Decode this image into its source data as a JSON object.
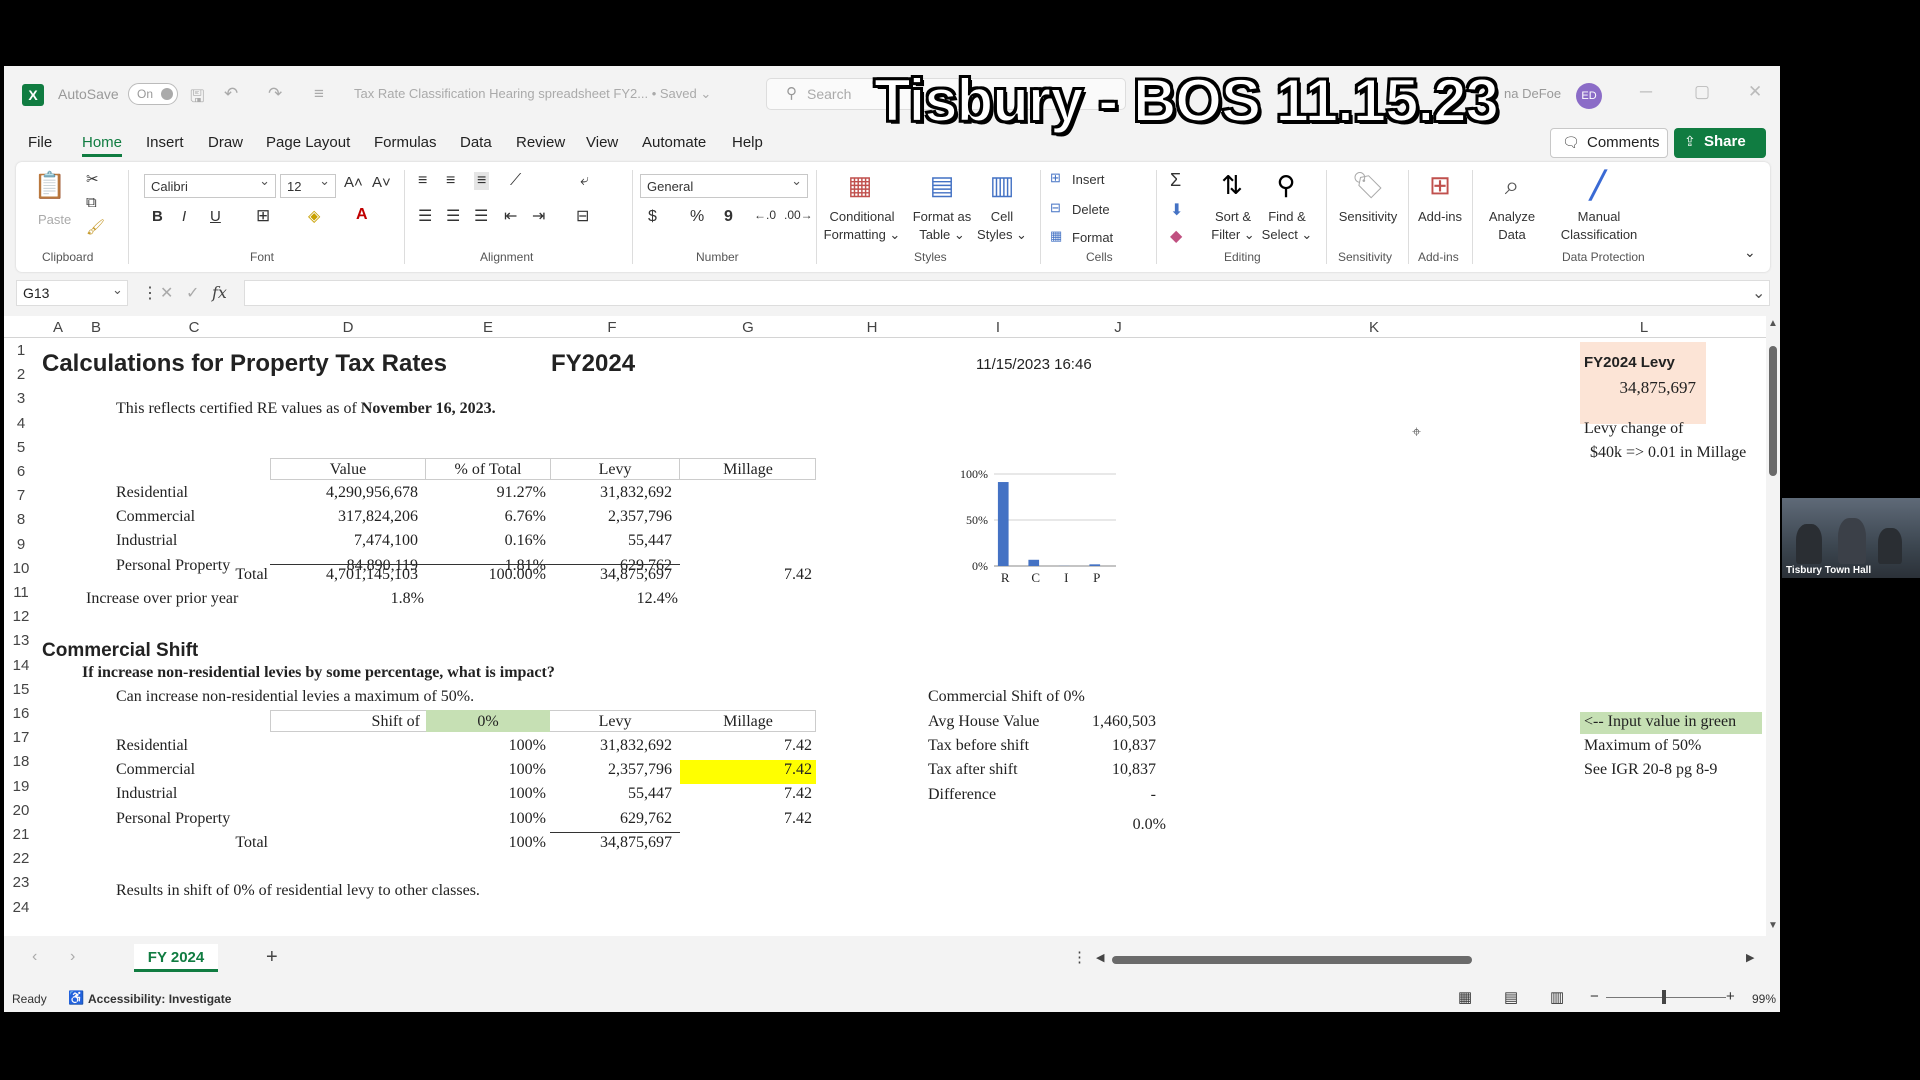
{
  "window": {
    "autosave_label": "AutoSave",
    "autosave_state": "On",
    "doc_title": "Tax Rate Classification Hearing spreadsheet FY2... • Saved ⌄",
    "search_placeholder": "Search",
    "overlay_title": "Tisbury - BOS 11.15.23",
    "username": "na DeFoe",
    "avatar_initials": "ED"
  },
  "menu": [
    "File",
    "Home",
    "Insert",
    "Draw",
    "Page Layout",
    "Formulas",
    "Data",
    "Review",
    "View",
    "Automate",
    "Help"
  ],
  "comments_label": "Comments",
  "share_label": "Share",
  "ribbon": {
    "clipboard": {
      "paste": "Paste",
      "group": "Clipboard"
    },
    "font": {
      "name": "Calibri",
      "size": "12",
      "group": "Font",
      "bold": "B",
      "italic": "I",
      "underline": "U"
    },
    "alignment": {
      "group": "Alignment"
    },
    "number": {
      "format": "General",
      "group": "Number",
      "currency": "$",
      "percent": "%",
      "comma": "9"
    },
    "styles": {
      "conditional": "Conditional\nFormatting ⌄",
      "format_table": "Format as\nTable ⌄",
      "cell_styles": "Cell\nStyles ⌄",
      "group": "Styles"
    },
    "cells": {
      "insert": "Insert",
      "delete": "Delete",
      "format": "Format",
      "group": "Cells"
    },
    "editing": {
      "sort": "Sort &\nFilter ⌄",
      "find": "Find &\nSelect ⌄",
      "group": "Editing"
    },
    "sensitivity": {
      "label": "Sensitivity",
      "group": "Sensitivity"
    },
    "addins": {
      "label": "Add-ins",
      "group": "Add-ins"
    },
    "analyze": {
      "label": "Analyze\nData"
    },
    "manual": {
      "label": "Manual\nClassification",
      "group": "Data Protection"
    }
  },
  "namebox": "G13",
  "columns": [
    "A",
    "B",
    "C",
    "D",
    "E",
    "F",
    "G",
    "H",
    "I",
    "J",
    "K",
    "L"
  ],
  "rows": [
    "1",
    "2",
    "3",
    "4",
    "5",
    "6",
    "7",
    "8",
    "9",
    "10",
    "11",
    "12",
    "13",
    "14",
    "15",
    "16",
    "17",
    "18",
    "19",
    "20",
    "21",
    "22",
    "23",
    "24"
  ],
  "sheet": {
    "title": "Calculations for Property Tax Rates",
    "fy": "FY2024",
    "timestamp": "11/15/2023 16:46",
    "note_pre": "This reflects certified RE values as of ",
    "note_date": "November 16, 2023.",
    "table1": {
      "headers": [
        "Value",
        "% of Total",
        "Levy",
        "Millage"
      ],
      "rows": [
        {
          "label": "Residential",
          "value": "4,290,956,678",
          "pct": "91.27%",
          "levy": "31,832,692"
        },
        {
          "label": "Commercial",
          "value": "317,824,206",
          "pct": "6.76%",
          "levy": "2,357,796"
        },
        {
          "label": "Industrial",
          "value": "7,474,100",
          "pct": "0.16%",
          "levy": "55,447"
        },
        {
          "label": "Personal Property",
          "value": "84,890,119",
          "pct": "1.81%",
          "levy": "629,762"
        }
      ],
      "total": {
        "label": "Total",
        "value": "4,701,145,103",
        "pct": "100.00%",
        "levy": "34,875,697",
        "millage": "7.42"
      },
      "increase": {
        "label": "Increase over prior year",
        "value": "1.8%",
        "levy": "12.4%"
      }
    },
    "section2_title": "Commercial Shift",
    "section2_question": "If increase non-residential levies by some percentage, what is impact?",
    "section2_note": "Can increase non-residential levies a maximum of 50%.",
    "table2": {
      "shift_label": "Shift of",
      "shift_value": "0%",
      "headers": [
        "Levy",
        "Millage"
      ],
      "rows": [
        {
          "label": "Residential",
          "pct": "100%",
          "levy": "31,832,692",
          "millage": "7.42"
        },
        {
          "label": "Commercial",
          "pct": "100%",
          "levy": "2,357,796",
          "millage": "7.42"
        },
        {
          "label": "Industrial",
          "pct": "100%",
          "levy": "55,447",
          "millage": "7.42"
        },
        {
          "label": "Personal Property",
          "pct": "100%",
          "levy": "629,762",
          "millage": "7.42"
        }
      ],
      "total": {
        "label": "Total",
        "pct": "100%",
        "levy": "34,875,697"
      }
    },
    "results_note": "Results in shift of 0% of residential levy to other classes.",
    "shift_panel": {
      "title": "Commercial Shift of 0%",
      "rows": [
        {
          "label": "Avg House Value",
          "value": "1,460,503"
        },
        {
          "label": "Tax before shift",
          "value": "10,837"
        },
        {
          "label": "Tax after shift",
          "value": "10,837"
        },
        {
          "label": "Difference",
          "value": "-"
        }
      ],
      "pct": "0.0%"
    },
    "levy_box": {
      "title": "FY2024  Levy",
      "value": "34,875,697"
    },
    "levy_change_line1": "Levy change of",
    "levy_change_line2": "$40k => 0.01 in Millage",
    "input_note": "<-- Input value in green",
    "max_note": "Maximum of 50%",
    "igr_note": "See IGR 20-8 pg 8-9"
  },
  "chart_data": {
    "type": "bar",
    "categories": [
      "R",
      "C",
      "I",
      "P"
    ],
    "values": [
      91.27,
      6.76,
      0.16,
      1.81
    ],
    "ylim": [
      0,
      100
    ],
    "yticks": [
      "0%",
      "50%",
      "100%"
    ],
    "grid": true,
    "bar_color": "#4472c4"
  },
  "sheet_tab": "FY 2024",
  "status": {
    "ready": "Ready",
    "accessibility": "Accessibility: Investigate",
    "zoom": "99%"
  },
  "webcam_label": "Tisbury Town Hall",
  "colors": {
    "excel_green": "#107c41",
    "highlight_yellow": "#ffff00",
    "input_green": "#c6e0b4",
    "levy_box": "#fce4d6"
  }
}
